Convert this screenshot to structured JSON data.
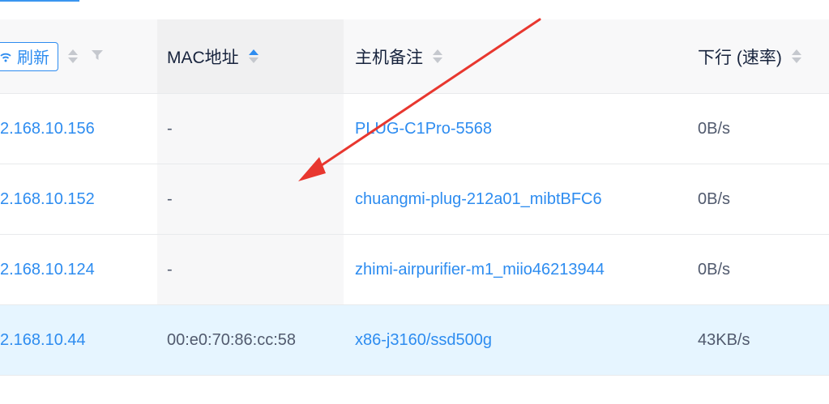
{
  "colors": {
    "accent": "#2d8cf0",
    "arrow": "#e8372f",
    "selected_row": "#e6f5ff"
  },
  "header": {
    "ip_refresh_label": "刷新",
    "mac_label": "MAC地址",
    "note_label": "主机备注",
    "down_label": "下行 (速率)"
  },
  "rows": [
    {
      "ip": "2.168.10.156",
      "mac": "-",
      "note": "PLUG-C1Pro-5568",
      "down": "0B/s"
    },
    {
      "ip": "2.168.10.152",
      "mac": "-",
      "note": "chuangmi-plug-212a01_mibtBFC6",
      "down": "0B/s"
    },
    {
      "ip": "2.168.10.124",
      "mac": "-",
      "note": "zhimi-airpurifier-m1_miio46213944",
      "down": "0B/s"
    },
    {
      "ip": "2.168.10.44",
      "mac": "00:e0:70:86:cc:58",
      "note": "x86-j3160/ssd500g",
      "down": "43KB/s"
    }
  ],
  "icons": {
    "refresh": "wifi-icon",
    "sort": "sort-caret-icon",
    "filter": "filter-icon"
  }
}
